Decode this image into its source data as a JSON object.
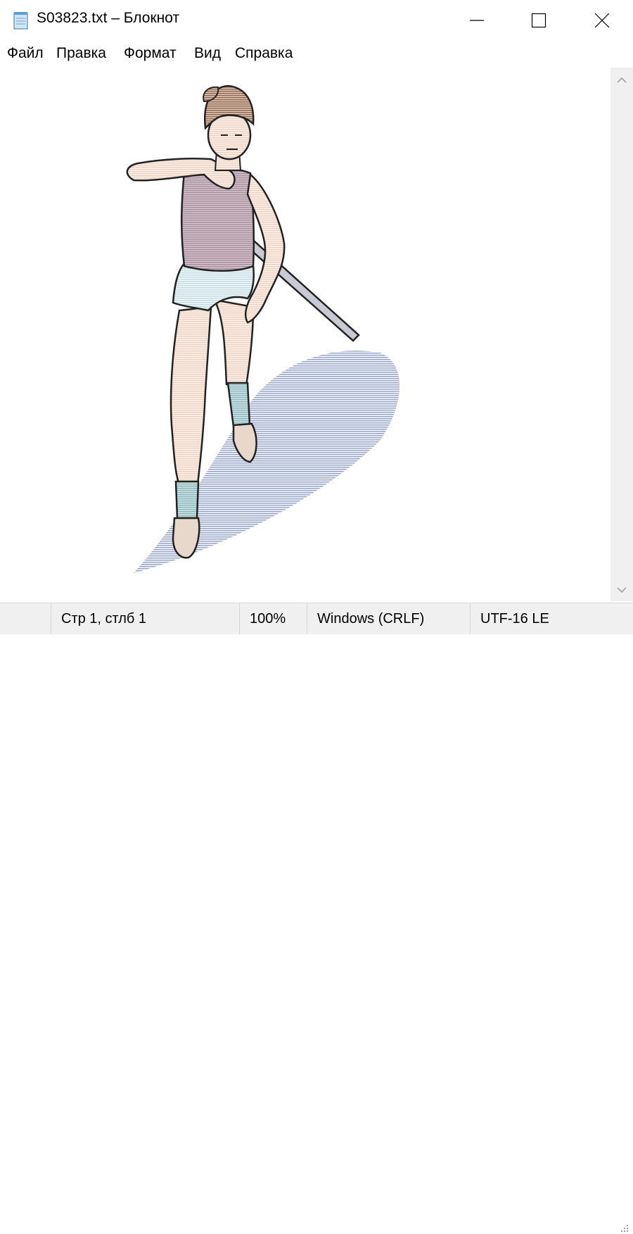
{
  "window": {
    "title": "S03823.txt – Блокнот",
    "icon": "notepad-icon",
    "controls": [
      "minimize-icon",
      "maximize-icon",
      "close-icon"
    ]
  },
  "menu": {
    "items": [
      "Файл",
      "Правка",
      "Формат",
      "Вид",
      "Справка"
    ]
  },
  "editor": {
    "content_description_icon": "figure-with-baton-ascii-art"
  },
  "statusbar": {
    "position": "Стр 1, стлб 1",
    "zoom": "100%",
    "line_endings": "Windows (CRLF)",
    "encoding": "UTF-16 LE"
  },
  "colors": {
    "chrome": "#f0f0f0",
    "border": "#d7d7d7",
    "shadow": "#9aa6c8",
    "skin": "#f0d9cc",
    "shirt": "#b9a3b0"
  }
}
